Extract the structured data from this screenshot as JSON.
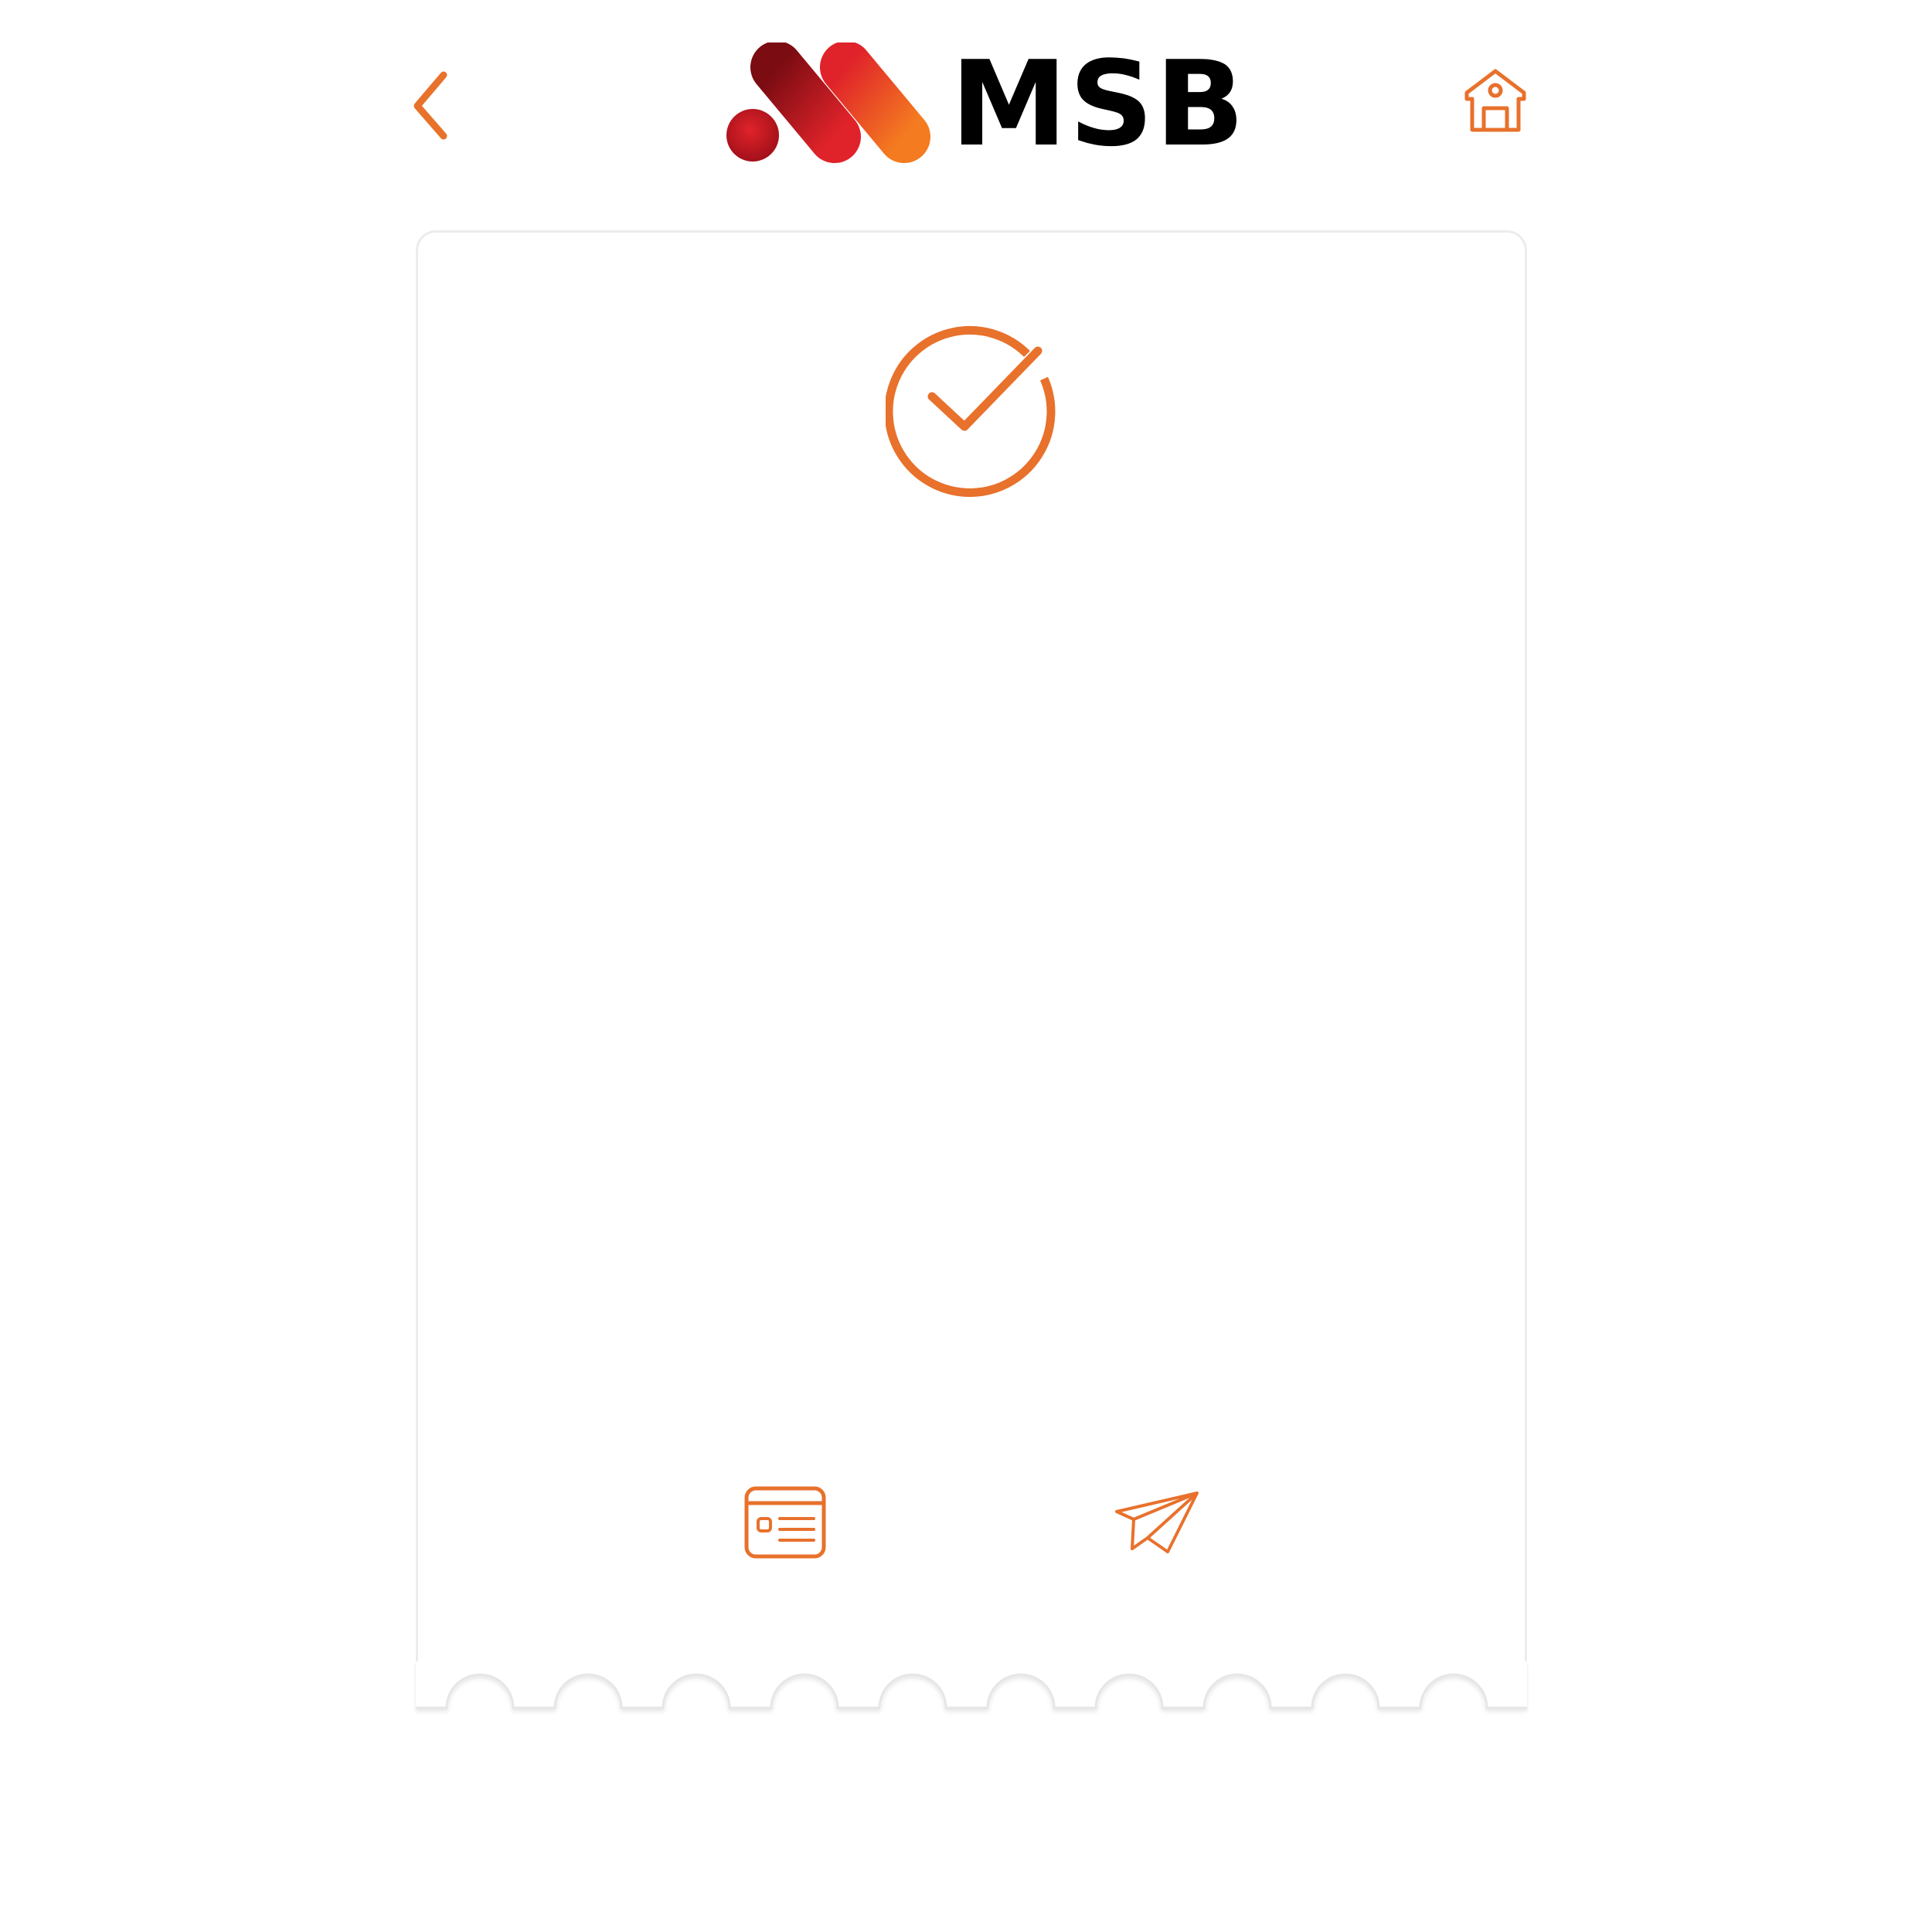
{
  "brand": {
    "name": "MSB",
    "accent_color": "#e8712c",
    "logo_colors": [
      "#b3121c",
      "#e0232a",
      "#f47b20"
    ]
  },
  "header": {
    "back_icon": "chevron-left-icon",
    "home_icon": "home-icon"
  },
  "receipt": {
    "status_icon": "check-circle-icon",
    "actions": [
      {
        "icon": "receipt-details-icon"
      },
      {
        "icon": "paper-plane-share-icon"
      }
    ]
  }
}
